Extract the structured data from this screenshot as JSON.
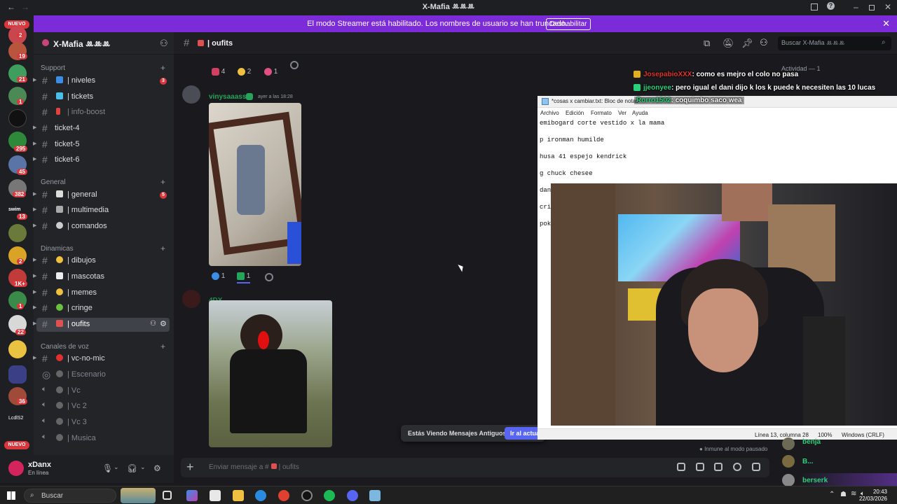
{
  "window": {
    "title": "X-Mafia ꔛꔛꔛ"
  },
  "banner": {
    "message": "El modo Streamer está habilitado. Los nombres de usuario se han truncado.",
    "button": "Deshabilitar"
  },
  "rail": {
    "nuevo_top": "NUEVO",
    "nuevo_bottom": "NUEVO",
    "badges": [
      "2",
      "19",
      "21",
      "1",
      "295",
      "45",
      "382",
      "13",
      "2",
      "1K+",
      "1",
      "22",
      "36"
    ],
    "label_swim": "swim",
    "label_lcd": "LcdlS2"
  },
  "server": {
    "name": "X-Mafia ꔛꔛꔛ"
  },
  "categories": {
    "support": "Support",
    "general": "General",
    "dinamicas": "Dinamicas",
    "voz": "Canales de voz"
  },
  "channels": {
    "niveles": "| niveles",
    "niveles_badge": "3",
    "tickets": "| tickets",
    "infoboost": "| info-boost",
    "ticket4": "ticket-4",
    "ticket5": "ticket-5",
    "ticket6": "ticket-6",
    "general": "| general",
    "general_badge": "5",
    "multimedia": "| multimedia",
    "comandos": "| comandos",
    "dibujos": "| dibujos",
    "mascotas": "| mascotas",
    "memes": "| memes",
    "cringe": "| cringe",
    "oufits": "| oufits",
    "vcnomic": "| vc-no-mic",
    "escenario": "| Escenario",
    "vc": "| Vc",
    "vc2": "| Vc 2",
    "vc3": "| Vc 3",
    "musica": "| Musica"
  },
  "user": {
    "name": "xDanx",
    "status": "En línea"
  },
  "chat": {
    "channel": "| oufits",
    "search_placeholder": "Buscar X-Mafia ꔛꔛꔛ",
    "top_reactions": [
      "4",
      "2",
      "1"
    ],
    "msg1": {
      "author": "vinysaaass",
      "time": "ayer a las 18:28",
      "reactions": [
        "1",
        "1"
      ]
    },
    "msg2": {
      "author": "4DX"
    },
    "composer_placeholder": "Enviar mensaje a #",
    "composer_channel": "| oufits",
    "old_notice": "Estás Viendo Mensajes Antiguos",
    "old_button": "Ir al actual",
    "immune": "Inmune al modo pausado",
    "activity": "Actividad — 1"
  },
  "stream_chat": [
    {
      "user": "JosepabioXXX",
      "text": ": como es mejro el colo no pasa",
      "color": "#e0332b"
    },
    {
      "user": "jjeonyee",
      "text": ": pero igual el dani dijo k los k puede k necesiten las 10 lucas",
      "color": "#2bd17a"
    },
    {
      "user": "Rorro1502",
      "text": ": coquimbo saco wea",
      "color": "#2bd17a"
    }
  ],
  "notepad": {
    "title": "*cosas x cambiar.txt: Bloc de notas",
    "menu": [
      "Archivo",
      "Edición",
      "Formato",
      "Ver",
      "Ayuda"
    ],
    "lines": [
      "emibogard corte vestido x la mama",
      "p ironman humilde",
      "husa 41 espejo kendrick",
      "g chuck chesee",
      "dan",
      "cri",
      "pok"
    ],
    "status": {
      "pos": "Línea 13, columna 28",
      "zoom": "100%",
      "eol": "Windows (CRLF)"
    }
  },
  "members": [
    {
      "name": "benja",
      "color": "#2bd17a"
    },
    {
      "name": "B...",
      "color": "#2bd17a"
    },
    {
      "name": "berserk",
      "color": "#2bd17a"
    }
  ],
  "taskbar": {
    "search": "Buscar",
    "time": "20:43",
    "date": "22/03/2026"
  }
}
